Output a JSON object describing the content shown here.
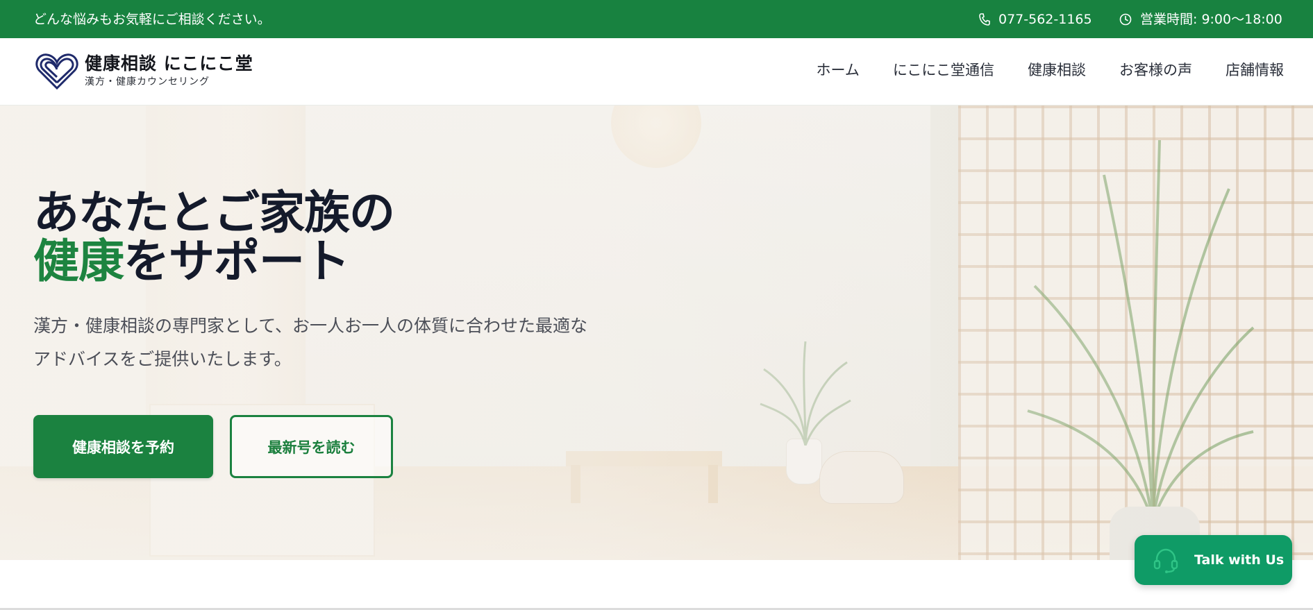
{
  "topbar": {
    "message": "どんな悩みもお気軽にご相談ください。",
    "phone": "077-562-1165",
    "hours": "営業時間: 9:00〜18:00",
    "phone_icon": "phone-icon",
    "clock_icon": "clock-icon"
  },
  "header": {
    "logo_title": "健康相談 にこにこ堂",
    "logo_subtitle": "漢方・健康カウンセリング",
    "nav": [
      {
        "label": "ホーム"
      },
      {
        "label": "にこにこ堂通信"
      },
      {
        "label": "健康相談"
      },
      {
        "label": "お客様の声"
      },
      {
        "label": "店舗情報"
      }
    ]
  },
  "hero": {
    "title_line1": "あなたとご家族の",
    "title_accent": "健康",
    "title_line2_rest": "をサポート",
    "description_line1": "漢方・健康相談の専門家として、お一人お一人の体質に合わせた最適な",
    "description_line2": "アドバイスをご提供いたします。",
    "primary_button": "健康相談を予約",
    "secondary_button": "最新号を読む"
  },
  "chat_widget": {
    "label": "Talk with Us",
    "icon": "headset-icon"
  },
  "colors": {
    "brand_green": "#188240",
    "chat_green": "#0f9b66",
    "heading_dark": "#141a2b"
  }
}
